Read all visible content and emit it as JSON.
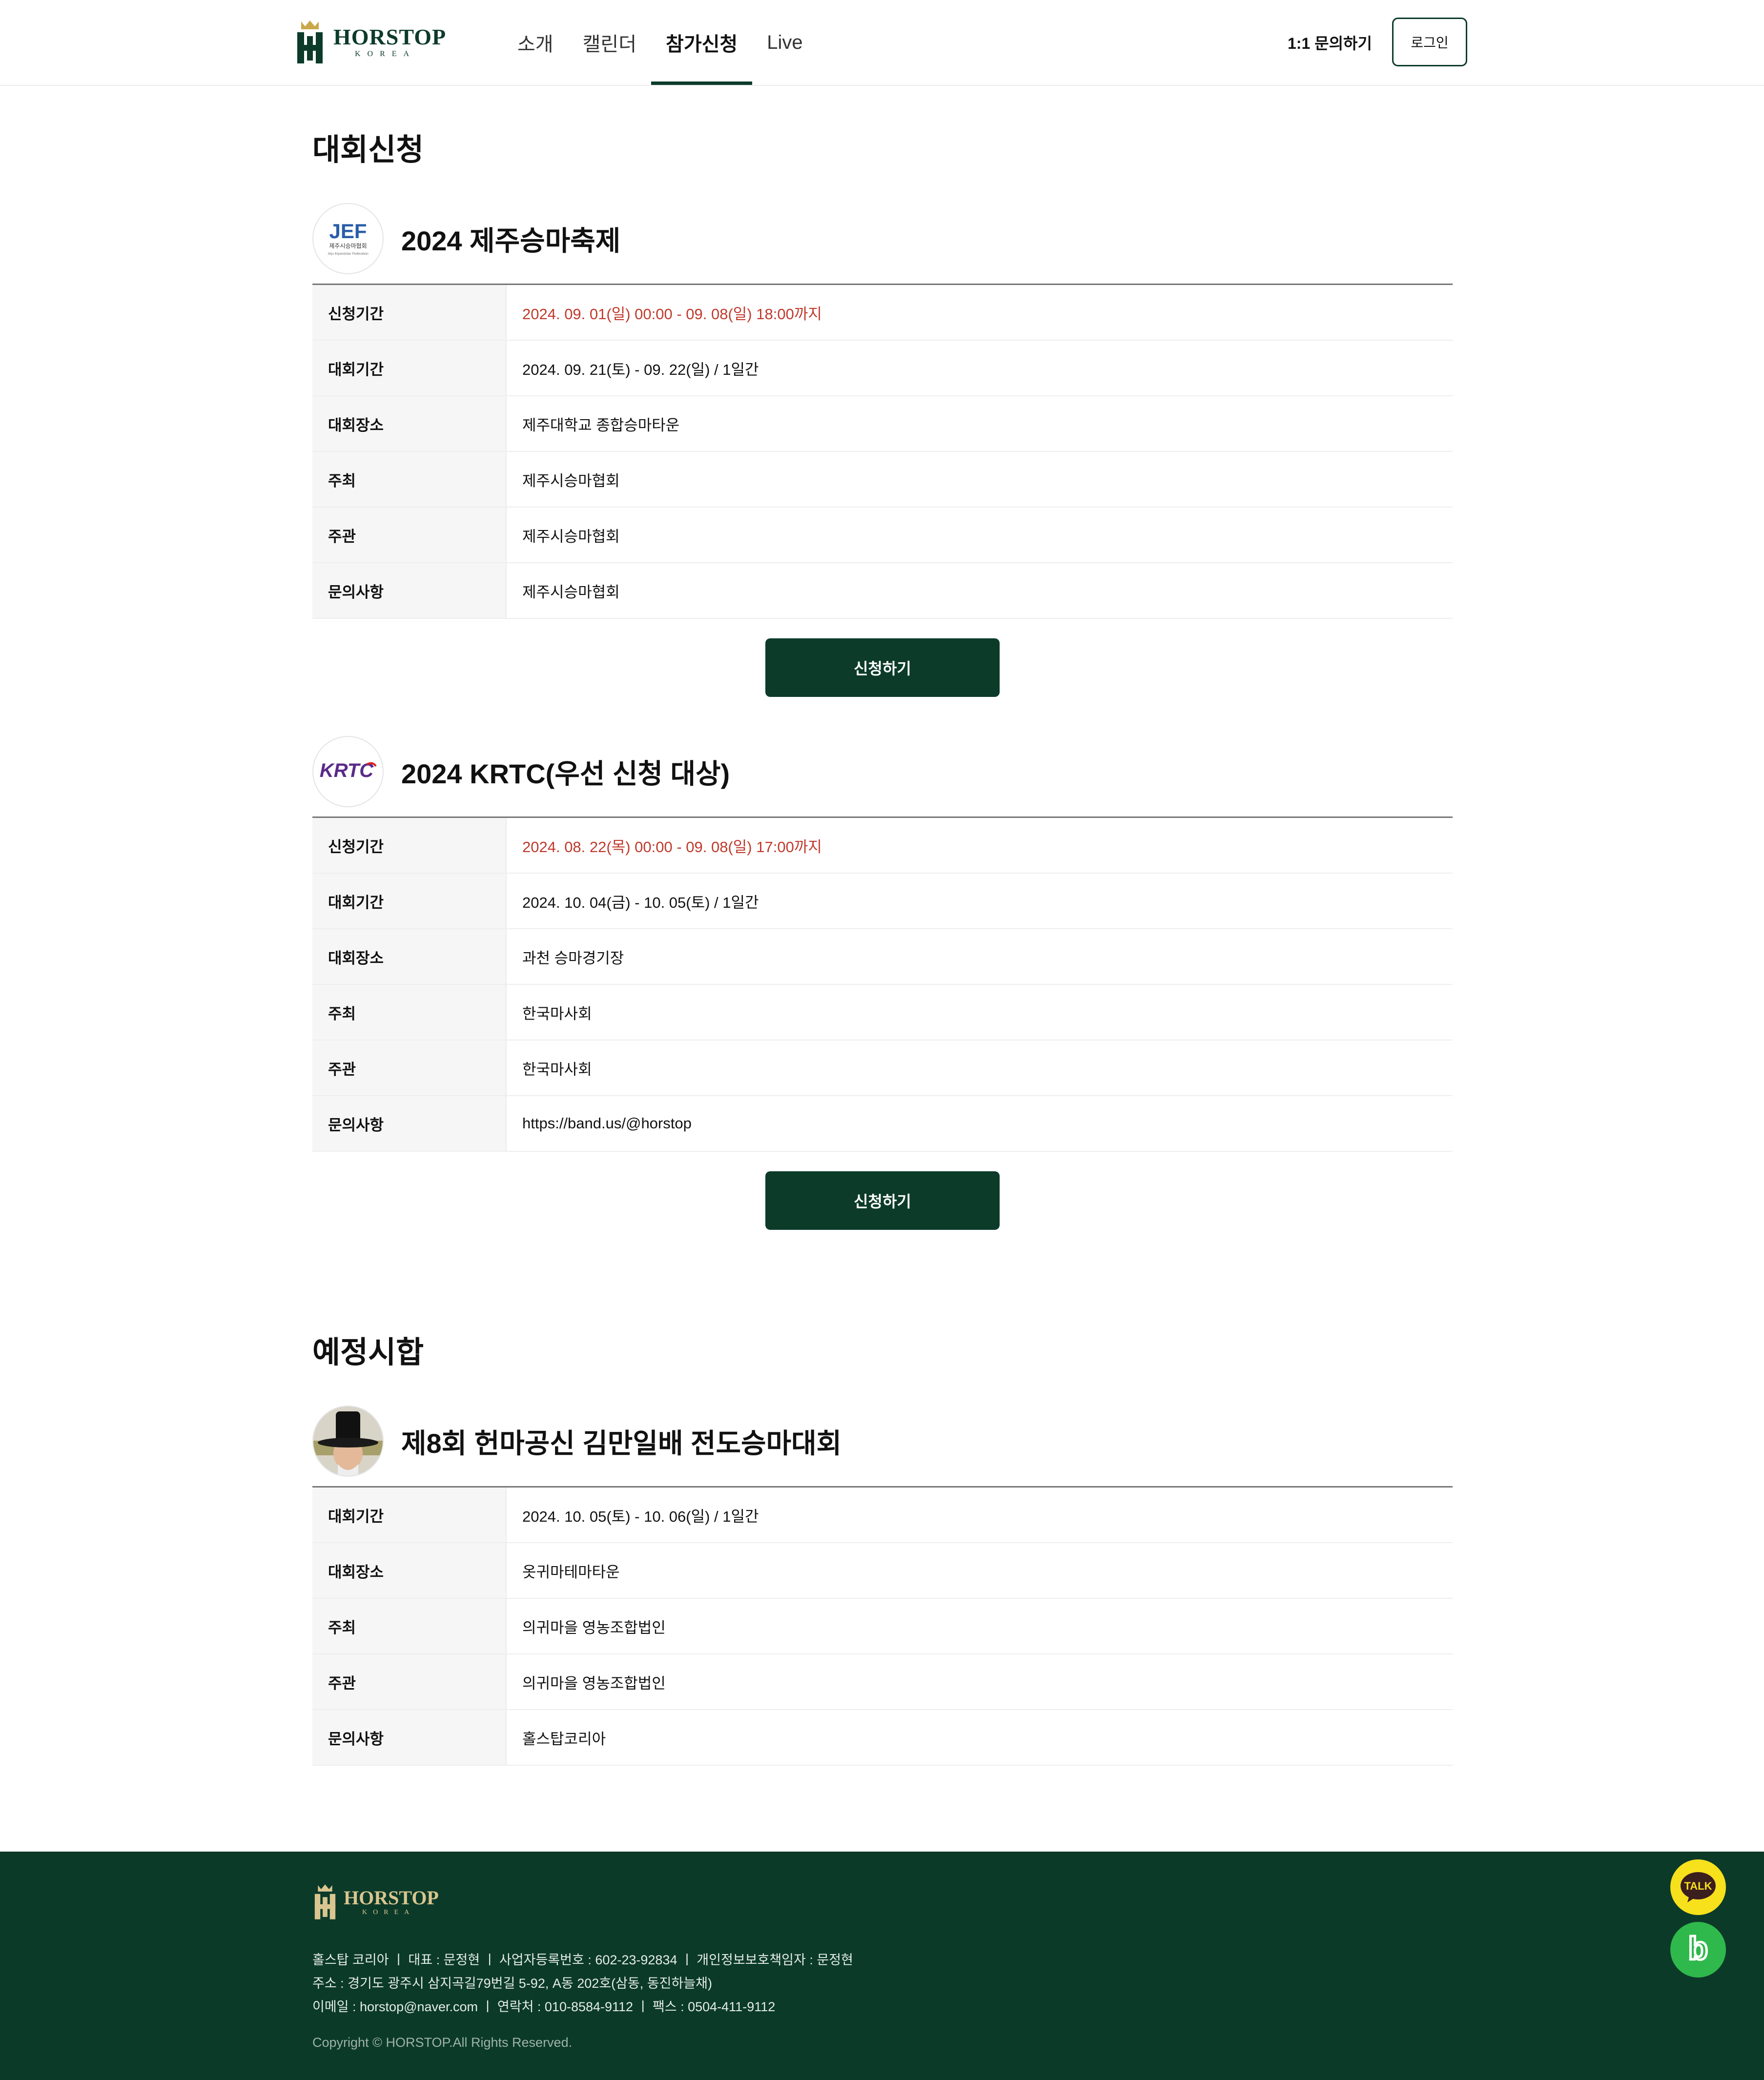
{
  "header": {
    "logo": {
      "brand": "HORSTOP",
      "sub": "KOREA"
    },
    "nav": [
      "소개",
      "캘린더",
      "참가신청",
      "Live"
    ],
    "nav_active_index": 2,
    "inquiry": "1:1 문의하기",
    "login": "로그인"
  },
  "apply_section": {
    "title": "대회신청",
    "events": [
      {
        "logo_text": "JEF",
        "logo_sub": "제주시승마협회",
        "logo_caption": "Jeju Equestrian Federation",
        "title": "2024 제주승마축제",
        "rows": [
          {
            "label": "신청기간",
            "value": "2024. 09. 01(일) 00:00 - 09. 08(일) 18:00까지"
          },
          {
            "label": "대회기간",
            "value": "2024. 09. 21(토) - 09. 22(일) / 1일간"
          },
          {
            "label": "대회장소",
            "value": "제주대학교 종합승마타운"
          },
          {
            "label": "주최",
            "value": "제주시승마협회"
          },
          {
            "label": "주관",
            "value": "제주시승마협회"
          },
          {
            "label": "문의사항",
            "value": "제주시승마협회"
          }
        ],
        "button": "신청하기"
      },
      {
        "logo_text": "KRTC",
        "logo_sub": "",
        "logo_caption": "",
        "title": "2024 KRTC(우선 신청 대상)",
        "rows": [
          {
            "label": "신청기간",
            "value": "2024. 08. 22(목) 00:00 - 09. 08(일) 17:00까지"
          },
          {
            "label": "대회기간",
            "value": "2024. 10. 04(금) - 10. 05(토) / 1일간"
          },
          {
            "label": "대회장소",
            "value": "과천 승마경기장"
          },
          {
            "label": "주최",
            "value": "한국마사회"
          },
          {
            "label": "주관",
            "value": "한국마사회"
          },
          {
            "label": "문의사항",
            "value": "https://band.us/@horstop"
          }
        ],
        "button": "신청하기"
      }
    ]
  },
  "upcoming_section": {
    "title": "예정시합",
    "events": [
      {
        "title": "제8회 헌마공신 김만일배 전도승마대회",
        "rows": [
          {
            "label": "대회기간",
            "value": "2024. 10. 05(토) - 10. 06(일) / 1일간"
          },
          {
            "label": "대회장소",
            "value": "옷귀마테마타운"
          },
          {
            "label": "주최",
            "value": "의귀마을 영농조합법인"
          },
          {
            "label": "주관",
            "value": "의귀마을 영농조합법인"
          },
          {
            "label": "문의사항",
            "value": "홀스탑코리아"
          }
        ]
      }
    ]
  },
  "footer": {
    "logo": {
      "brand": "HORSTOP",
      "sub": "KOREA"
    },
    "line1": "홀스탑 코리아  ㅣ  대표 : 문정현  ㅣ  사업자등록번호 : 602-23-92834  ㅣ  개인정보보호책임자 : 문정현",
    "line2": "주소 : 경기도 광주시 삼지곡길79번길 5-92, A동 202호(삼동, 동진하늘채)",
    "line3": "이메일 : horstop@naver.com  ㅣ  연락처 : 010-8584-9112  ㅣ  팩스 : 0504-411-9112",
    "copyright": "Copyright © HORSTOP.All Rights Reserved."
  },
  "floating": {
    "kakao": "TALK",
    "band": "b"
  },
  "colors": {
    "brand_green": "#0c3b2a",
    "footer_bg": "#0b3a29",
    "highlight_red": "#c0392b",
    "gold": "#d9c58f"
  }
}
